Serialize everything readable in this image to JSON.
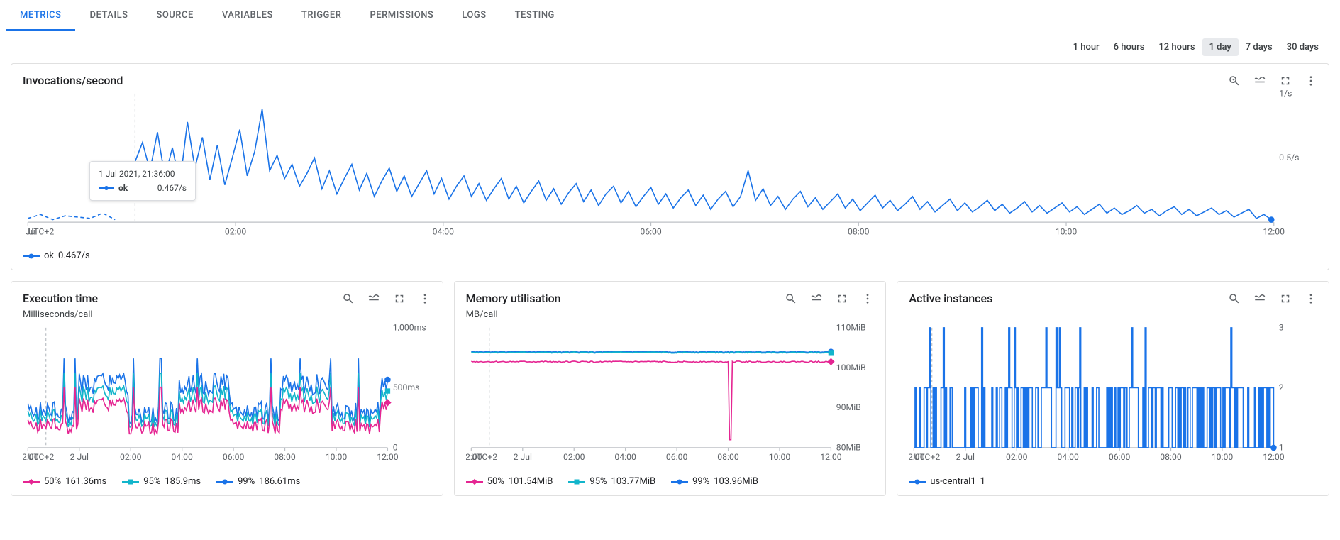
{
  "tabs": [
    "METRICS",
    "DETAILS",
    "SOURCE",
    "VARIABLES",
    "TRIGGER",
    "PERMISSIONS",
    "LOGS",
    "TESTING"
  ],
  "tabs_active_index": 0,
  "time_ranges": [
    "1 hour",
    "6 hours",
    "12 hours",
    "1 day",
    "7 days",
    "30 days"
  ],
  "time_ranges_active_index": 3,
  "axis_timezone_label": "UTC+2",
  "colors": {
    "blue": "#1a73e8",
    "teal": "#12b5cb",
    "magenta": "#e52592",
    "grey": "#5f6368"
  },
  "tooltip": {
    "timestamp": "1 Jul 2021, 21:36:00",
    "series_label": "ok",
    "value": "0.467/s"
  },
  "chart_data": [
    {
      "id": "invocations",
      "title": "Invocations/second",
      "type": "line",
      "xlabels": [
        "2 Jul",
        "02:00",
        "04:00",
        "06:00",
        "08:00",
        "10:00",
        "12:00"
      ],
      "yticks": [
        {
          "v": 0.5,
          "label": "0.5/s"
        },
        {
          "v": 1.0,
          "label": "1/s"
        }
      ],
      "ylim": [
        0,
        1.0
      ],
      "cursor_x_fraction": 0.086,
      "legend": [
        {
          "marker": "line-dot",
          "color": "blue",
          "label": "ok",
          "value": "0.467/s"
        }
      ],
      "series": [
        {
          "name": "ok",
          "color": "blue",
          "gap_fraction": [
            0,
            0.074
          ],
          "values_fraction": [
            [
              0.0,
              0.03
            ],
            [
              0.01,
              0.06
            ],
            [
              0.02,
              0.02
            ],
            [
              0.03,
              0.05
            ],
            [
              0.04,
              0.04
            ],
            [
              0.05,
              0.03
            ],
            [
              0.06,
              0.07
            ],
            [
              0.07,
              0.02
            ],
            [
              0.081,
              0.34
            ],
            [
              0.086,
              0.47
            ],
            [
              0.092,
              0.62
            ],
            [
              0.098,
              0.4
            ],
            [
              0.104,
              0.7
            ],
            [
              0.11,
              0.35
            ],
            [
              0.116,
              0.58
            ],
            [
              0.122,
              0.3
            ],
            [
              0.128,
              0.78
            ],
            [
              0.134,
              0.42
            ],
            [
              0.14,
              0.66
            ],
            [
              0.146,
              0.33
            ],
            [
              0.152,
              0.6
            ],
            [
              0.158,
              0.29
            ],
            [
              0.164,
              0.5
            ],
            [
              0.17,
              0.72
            ],
            [
              0.176,
              0.36
            ],
            [
              0.182,
              0.55
            ],
            [
              0.188,
              0.88
            ],
            [
              0.194,
              0.4
            ],
            [
              0.2,
              0.52
            ],
            [
              0.206,
              0.34
            ],
            [
              0.212,
              0.45
            ],
            [
              0.218,
              0.28
            ],
            [
              0.224,
              0.38
            ],
            [
              0.23,
              0.5
            ],
            [
              0.236,
              0.26
            ],
            [
              0.242,
              0.4
            ],
            [
              0.248,
              0.22
            ],
            [
              0.254,
              0.34
            ],
            [
              0.26,
              0.45
            ],
            [
              0.266,
              0.25
            ],
            [
              0.272,
              0.38
            ],
            [
              0.278,
              0.2
            ],
            [
              0.284,
              0.32
            ],
            [
              0.29,
              0.42
            ],
            [
              0.296,
              0.24
            ],
            [
              0.302,
              0.36
            ],
            [
              0.308,
              0.2
            ],
            [
              0.314,
              0.3
            ],
            [
              0.32,
              0.4
            ],
            [
              0.326,
              0.22
            ],
            [
              0.332,
              0.34
            ],
            [
              0.338,
              0.18
            ],
            [
              0.344,
              0.28
            ],
            [
              0.35,
              0.36
            ],
            [
              0.356,
              0.2
            ],
            [
              0.362,
              0.3
            ],
            [
              0.368,
              0.17
            ],
            [
              0.374,
              0.26
            ],
            [
              0.38,
              0.34
            ],
            [
              0.386,
              0.18
            ],
            [
              0.392,
              0.28
            ],
            [
              0.398,
              0.15
            ],
            [
              0.404,
              0.24
            ],
            [
              0.41,
              0.32
            ],
            [
              0.416,
              0.17
            ],
            [
              0.422,
              0.26
            ],
            [
              0.428,
              0.14
            ],
            [
              0.434,
              0.23
            ],
            [
              0.44,
              0.3
            ],
            [
              0.446,
              0.16
            ],
            [
              0.452,
              0.25
            ],
            [
              0.458,
              0.13
            ],
            [
              0.464,
              0.22
            ],
            [
              0.47,
              0.28
            ],
            [
              0.476,
              0.15
            ],
            [
              0.482,
              0.24
            ],
            [
              0.488,
              0.12
            ],
            [
              0.494,
              0.2
            ],
            [
              0.5,
              0.27
            ],
            [
              0.506,
              0.14
            ],
            [
              0.512,
              0.22
            ],
            [
              0.518,
              0.11
            ],
            [
              0.524,
              0.19
            ],
            [
              0.53,
              0.25
            ],
            [
              0.536,
              0.13
            ],
            [
              0.542,
              0.21
            ],
            [
              0.548,
              0.1
            ],
            [
              0.554,
              0.18
            ],
            [
              0.56,
              0.24
            ],
            [
              0.566,
              0.12
            ],
            [
              0.572,
              0.2
            ],
            [
              0.578,
              0.4
            ],
            [
              0.584,
              0.17
            ],
            [
              0.59,
              0.26
            ],
            [
              0.596,
              0.13
            ],
            [
              0.602,
              0.2
            ],
            [
              0.608,
              0.1
            ],
            [
              0.614,
              0.18
            ],
            [
              0.62,
              0.24
            ],
            [
              0.626,
              0.12
            ],
            [
              0.632,
              0.19
            ],
            [
              0.638,
              0.1
            ],
            [
              0.644,
              0.16
            ],
            [
              0.65,
              0.22
            ],
            [
              0.656,
              0.11
            ],
            [
              0.662,
              0.18
            ],
            [
              0.668,
              0.09
            ],
            [
              0.674,
              0.15
            ],
            [
              0.68,
              0.21
            ],
            [
              0.686,
              0.11
            ],
            [
              0.692,
              0.17
            ],
            [
              0.698,
              0.09
            ],
            [
              0.704,
              0.14
            ],
            [
              0.71,
              0.2
            ],
            [
              0.716,
              0.1
            ],
            [
              0.722,
              0.16
            ],
            [
              0.728,
              0.08
            ],
            [
              0.734,
              0.13
            ],
            [
              0.74,
              0.18
            ],
            [
              0.746,
              0.09
            ],
            [
              0.752,
              0.15
            ],
            [
              0.758,
              0.08
            ],
            [
              0.764,
              0.12
            ],
            [
              0.77,
              0.17
            ],
            [
              0.776,
              0.09
            ],
            [
              0.782,
              0.14
            ],
            [
              0.788,
              0.07
            ],
            [
              0.794,
              0.11
            ],
            [
              0.8,
              0.16
            ],
            [
              0.806,
              0.08
            ],
            [
              0.812,
              0.13
            ],
            [
              0.818,
              0.07
            ],
            [
              0.824,
              0.11
            ],
            [
              0.83,
              0.15
            ],
            [
              0.836,
              0.08
            ],
            [
              0.842,
              0.12
            ],
            [
              0.848,
              0.06
            ],
            [
              0.854,
              0.1
            ],
            [
              0.86,
              0.14
            ],
            [
              0.866,
              0.07
            ],
            [
              0.872,
              0.11
            ],
            [
              0.878,
              0.06
            ],
            [
              0.884,
              0.09
            ],
            [
              0.89,
              0.13
            ],
            [
              0.896,
              0.07
            ],
            [
              0.902,
              0.1
            ],
            [
              0.908,
              0.05
            ],
            [
              0.914,
              0.09
            ],
            [
              0.92,
              0.12
            ],
            [
              0.926,
              0.06
            ],
            [
              0.932,
              0.1
            ],
            [
              0.938,
              0.05
            ],
            [
              0.944,
              0.08
            ],
            [
              0.95,
              0.11
            ],
            [
              0.956,
              0.06
            ],
            [
              0.962,
              0.09
            ],
            [
              0.968,
              0.04
            ],
            [
              0.974,
              0.07
            ],
            [
              0.98,
              0.1
            ],
            [
              0.986,
              0.03
            ],
            [
              0.992,
              0.06
            ],
            [
              0.998,
              0.02
            ]
          ]
        }
      ]
    },
    {
      "id": "execution_time",
      "title": "Execution time",
      "subtitle": "Milliseconds/call",
      "type": "line",
      "xlabels": [
        "22:00",
        "2 Jul",
        "02:00",
        "04:00",
        "06:00",
        "08:00",
        "10:00",
        "12:00"
      ],
      "yticks": [
        {
          "v": 0,
          "label": "0"
        },
        {
          "v": 500,
          "label": "500ms"
        },
        {
          "v": 1000,
          "label": "1,000ms"
        }
      ],
      "ylim": [
        0,
        1000
      ],
      "cursor_x_fraction": 0.05,
      "legend": [
        {
          "marker": "line-diamond",
          "color": "magenta",
          "label": "50%",
          "value": "161.36ms"
        },
        {
          "marker": "line-square",
          "color": "teal",
          "label": "95%",
          "value": "185.9ms"
        },
        {
          "marker": "line-dot",
          "color": "blue",
          "label": "99%",
          "value": "186.61ms"
        }
      ],
      "series": [
        {
          "name": "99%",
          "color": "blue",
          "pattern": "step-noise",
          "base": 240,
          "amp": 360,
          "period": 0.14
        },
        {
          "name": "95%",
          "color": "teal",
          "pattern": "step-noise",
          "base": 200,
          "amp": 300,
          "period": 0.14
        },
        {
          "name": "50%",
          "color": "magenta",
          "pattern": "step-noise",
          "base": 140,
          "amp": 260,
          "period": 0.14
        }
      ]
    },
    {
      "id": "memory",
      "title": "Memory utilisation",
      "subtitle": "MB/call",
      "type": "line",
      "xlabels": [
        "22:00",
        "2 Jul",
        "02:00",
        "04:00",
        "06:00",
        "08:00",
        "10:00",
        "12:00"
      ],
      "yticks": [
        {
          "v": 80,
          "label": "80MiB"
        },
        {
          "v": 90,
          "label": "90MiB"
        },
        {
          "v": 100,
          "label": "100MiB"
        },
        {
          "v": 110,
          "label": "110MiB"
        }
      ],
      "ylim": [
        80,
        110
      ],
      "cursor_x_fraction": 0.05,
      "legend": [
        {
          "marker": "line-diamond",
          "color": "magenta",
          "label": "50%",
          "value": "101.54MiB"
        },
        {
          "marker": "line-square",
          "color": "teal",
          "label": "95%",
          "value": "103.77MiB"
        },
        {
          "marker": "line-dot",
          "color": "blue",
          "label": "99%",
          "value": "103.96MiB"
        }
      ],
      "series": [
        {
          "name": "99%",
          "color": "blue",
          "pattern": "flat",
          "level": 104,
          "dip_at": null
        },
        {
          "name": "95%",
          "color": "teal",
          "pattern": "flat",
          "level": 103.8,
          "dip_at": null
        },
        {
          "name": "50%",
          "color": "magenta",
          "pattern": "flat",
          "level": 101.5,
          "dip_at": 0.72,
          "dip_level": 82
        }
      ]
    },
    {
      "id": "instances",
      "title": "Active instances",
      "type": "line",
      "xlabels": [
        "22:00",
        "2 Jul",
        "02:00",
        "04:00",
        "06:00",
        "08:00",
        "10:00",
        "12:00"
      ],
      "yticks": [
        {
          "v": 1,
          "label": "1"
        },
        {
          "v": 2,
          "label": "2"
        },
        {
          "v": 3,
          "label": "3"
        }
      ],
      "ylim": [
        1,
        3
      ],
      "cursor_x_fraction": 0.05,
      "legend": [
        {
          "marker": "line-dot",
          "color": "blue",
          "label": "us-central1",
          "value": "1"
        }
      ],
      "series": [
        {
          "name": "us-central1",
          "color": "blue",
          "pattern": "spikes",
          "base": 1,
          "spike_to": 2,
          "rare_spike_to": 3
        }
      ]
    }
  ]
}
